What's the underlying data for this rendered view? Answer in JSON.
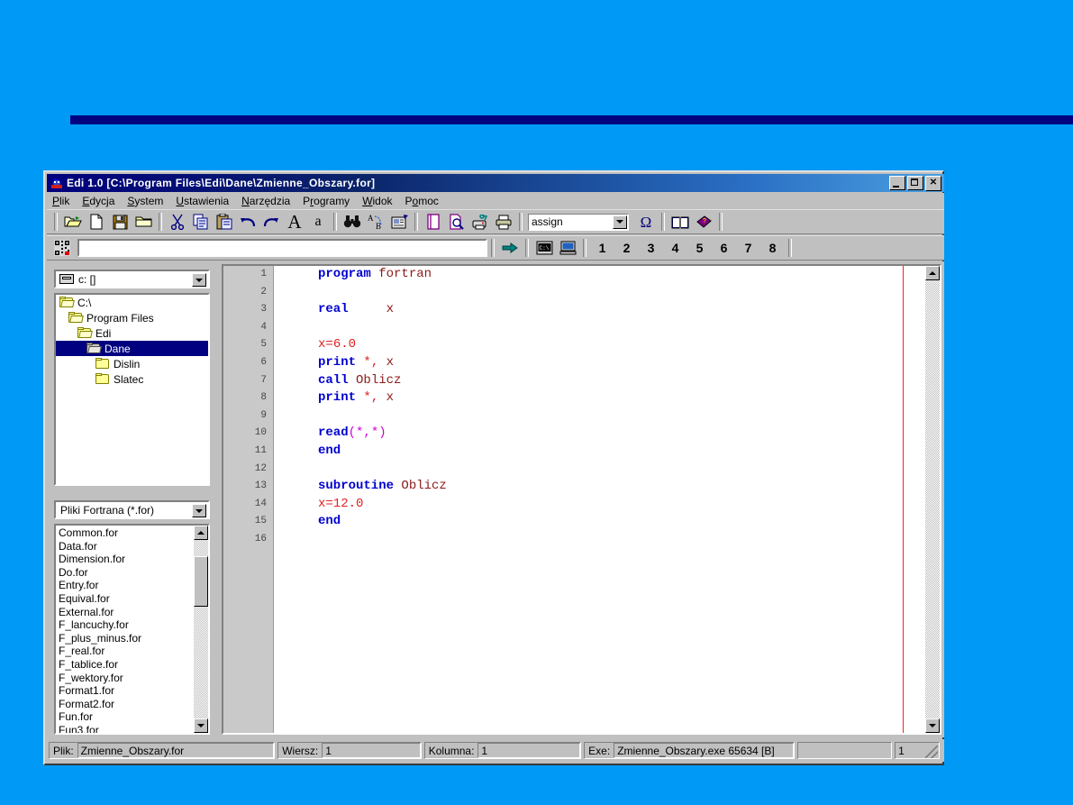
{
  "window": {
    "title": "Edi 1.0 [C:\\Program Files\\Edi\\Dane\\Zmienne_Obszary.for]",
    "app_icon": "edi-app-icon",
    "buttons": {
      "minimize": "_",
      "maximize": "□",
      "close": "✕"
    }
  },
  "menubar": {
    "items": [
      {
        "label": "Plik",
        "accel": "P"
      },
      {
        "label": "Edycja",
        "accel": "E"
      },
      {
        "label": "System",
        "accel": "S"
      },
      {
        "label": "Ustawienia",
        "accel": "U"
      },
      {
        "label": "Narzędzia",
        "accel": "N"
      },
      {
        "label": "Programy",
        "accel": "r"
      },
      {
        "label": "Widok",
        "accel": "W"
      },
      {
        "label": "Pomoc",
        "accel": "o"
      }
    ]
  },
  "toolbar1": {
    "buttons": [
      {
        "name": "open-folder-icon",
        "tip": "Otwórz"
      },
      {
        "name": "new-file-icon",
        "tip": "Nowy"
      },
      {
        "name": "save-disk-icon",
        "tip": "Zapisz"
      },
      {
        "name": "folder-icon",
        "tip": "Katalog"
      },
      {
        "name": "cut-scissors-icon",
        "tip": "Wytnij"
      },
      {
        "name": "copy-icon",
        "tip": "Kopiuj"
      },
      {
        "name": "paste-icon",
        "tip": "Wklej"
      },
      {
        "name": "undo-arrow-icon",
        "tip": "Cofnij"
      },
      {
        "name": "redo-arrow-icon",
        "tip": "Ponów"
      },
      {
        "name": "font-large-a-icon",
        "tip": "Duża czcionka"
      },
      {
        "name": "font-small-a-icon",
        "tip": "Mała czcionka"
      },
      {
        "name": "find-binoculars-icon",
        "tip": "Znajdź"
      },
      {
        "name": "replace-ab-icon",
        "tip": "Zamień"
      },
      {
        "name": "properties-icon",
        "tip": "Właściwości"
      },
      {
        "name": "page-icon",
        "tip": "Strona"
      },
      {
        "name": "print-preview-icon",
        "tip": "Podgląd wydruku"
      },
      {
        "name": "printer-setup-icon",
        "tip": "Ustawienia drukarki"
      },
      {
        "name": "print-icon",
        "tip": "Drukuj"
      }
    ],
    "combo": {
      "value": "assign",
      "placeholder": "assign"
    },
    "omega_label": "Ω",
    "after_combo": [
      {
        "name": "book-open-icon",
        "tip": "Pomoc"
      },
      {
        "name": "book-help-icon",
        "tip": "Podręcznik"
      }
    ]
  },
  "toolbar2": {
    "grid_icon": "barcode-grid-icon",
    "address_value": "",
    "address_placeholder": "",
    "go_icon": "go-arrow-icon",
    "console_icon": "console-window-icon",
    "computer_icon": "computer-icon",
    "numbers": [
      "1",
      "2",
      "3",
      "4",
      "5",
      "6",
      "7",
      "8"
    ]
  },
  "left_panel": {
    "drive_combo": {
      "icon": "drive-icon",
      "value": "c: []"
    },
    "tree": [
      {
        "label": "C:\\",
        "indent": 0,
        "icon": "folder-open-icon",
        "selected": false
      },
      {
        "label": "Program Files",
        "indent": 1,
        "icon": "folder-open-icon",
        "selected": false
      },
      {
        "label": "Edi",
        "indent": 2,
        "icon": "folder-open-icon",
        "selected": false
      },
      {
        "label": "Dane",
        "indent": 3,
        "icon": "folder-open-sel-icon",
        "selected": true
      },
      {
        "label": "Dislin",
        "indent": 4,
        "icon": "folder-icon",
        "selected": false
      },
      {
        "label": "Slatec",
        "indent": 4,
        "icon": "folder-icon",
        "selected": false
      }
    ],
    "filter_combo": {
      "value": "Pliki Fortrana (*.for)"
    },
    "files": [
      "Common.for",
      "Data.for",
      "Dimension.for",
      "Do.for",
      "Entry.for",
      "Equival.for",
      "External.for",
      "F_lancuchy.for",
      "F_plus_minus.for",
      "F_real.for",
      "F_tablice.for",
      "F_wektory.for",
      "Format1.for",
      "Format2.for",
      "Fun.for",
      "Fun3.for"
    ]
  },
  "editor": {
    "line_numbers": [
      "1",
      "2",
      "3",
      "4",
      "5",
      "6",
      "7",
      "8",
      "9",
      "10",
      "11",
      "12",
      "13",
      "14",
      "15",
      "16"
    ],
    "lines": [
      [
        {
          "t": "program",
          "c": "kw"
        },
        {
          "t": " ",
          "c": "pl"
        },
        {
          "t": "fortran",
          "c": "id"
        }
      ],
      [],
      [
        {
          "t": "real",
          "c": "kw"
        },
        {
          "t": "     ",
          "c": "pl"
        },
        {
          "t": "x",
          "c": "id"
        }
      ],
      [],
      [
        {
          "t": "x",
          "c": "num"
        },
        {
          "t": "=",
          "c": "num"
        },
        {
          "t": "6.0",
          "c": "num"
        }
      ],
      [
        {
          "t": "print",
          "c": "kw"
        },
        {
          "t": " ",
          "c": "pl"
        },
        {
          "t": "*,",
          "c": "num"
        },
        {
          "t": " ",
          "c": "pl"
        },
        {
          "t": "x",
          "c": "id"
        }
      ],
      [
        {
          "t": "call",
          "c": "kw"
        },
        {
          "t": " ",
          "c": "pl"
        },
        {
          "t": "Oblicz",
          "c": "id"
        }
      ],
      [
        {
          "t": "print",
          "c": "kw"
        },
        {
          "t": " ",
          "c": "pl"
        },
        {
          "t": "*,",
          "c": "num"
        },
        {
          "t": " ",
          "c": "pl"
        },
        {
          "t": "x",
          "c": "id"
        }
      ],
      [],
      [
        {
          "t": "read",
          "c": "kw"
        },
        {
          "t": "(*,*)",
          "c": "pm"
        }
      ],
      [
        {
          "t": "end",
          "c": "kw"
        }
      ],
      [],
      [
        {
          "t": "subroutine",
          "c": "kw"
        },
        {
          "t": " ",
          "c": "pl"
        },
        {
          "t": "Oblicz",
          "c": "id"
        }
      ],
      [
        {
          "t": "x=12.0",
          "c": "num"
        }
      ],
      [
        {
          "t": "end",
          "c": "kw"
        }
      ],
      []
    ],
    "margin_guide_color": "#ff2020"
  },
  "statusbar": {
    "file_label": "Plik:",
    "file_value": "Zmienne_Obszary.for",
    "line_label": "Wiersz:",
    "line_value": "1",
    "column_label": "Kolumna:",
    "column_value": "1",
    "exe_label": "Exe:",
    "exe_value": "Zmienne_Obszary.exe 65634 [B]",
    "blank_value": "",
    "last_value": "1"
  },
  "colors": {
    "desktop_background": "#0099f5",
    "accent_bar": "#000080",
    "window_face": "#c0c0c0",
    "title_active": "#0a246a",
    "selection": "#000080",
    "keyword": "#0000d0",
    "identifier": "#8b1a1a",
    "number": "#e02020",
    "punctuation": "#d000d0"
  }
}
